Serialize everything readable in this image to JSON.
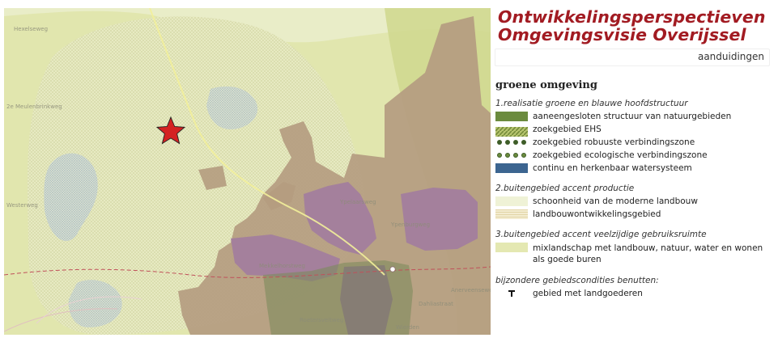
{
  "legend": {
    "title_line1": "Ontwikkelingsperspectieven",
    "title_line2": "Omgevingsvisie Overijssel",
    "subtitle": "aanduidingen",
    "section": "groene omgeving",
    "groups": [
      {
        "heading": "1.realisatie groene en blauwe hoofdstructuur",
        "items": [
          {
            "label": "aaneengesloten structuur van natuurgebieden",
            "color": "#6b8b3e"
          },
          {
            "label": "zoekgebied EHS",
            "color": "#8aa64a"
          },
          {
            "label": "zoekgebied robuuste verbindingszone",
            "color": "#3e5d28"
          },
          {
            "label": "zoekgebied ecologische verbindingszone",
            "color": "#6b8b3e"
          },
          {
            "label": "continu en herkenbaar watersysteem",
            "color": "#3c6590"
          }
        ]
      },
      {
        "heading": "2.buitengebied accent productie",
        "items": [
          {
            "label": "schoonheid van de moderne landbouw",
            "color": "#eff2d6"
          },
          {
            "label": "landbouwontwikkelingsgebied",
            "color": "#e9dfc0"
          }
        ]
      },
      {
        "heading": "3.buitengebied accent veelzijdige gebruiksruimte",
        "items": [
          {
            "label": "mixlandschap met landbouw, natuur, water en wonen als goede buren",
            "color": "#e4e8b2"
          }
        ]
      },
      {
        "heading": "bijzondere gebiedscondities benutten:",
        "items": [
          {
            "label": "gebied met landgoederen",
            "icon": "landgoed-icon"
          }
        ]
      }
    ]
  },
  "map": {
    "street_labels": [
      "Hexelseweg",
      "Ypelaarsweg",
      "Ypenburgweg",
      "Anerveenseweg",
      "Dahliastraat",
      "Wierden",
      "Mekkelhorstweg",
      "Roetersveltweg",
      "2e Meulenbrinkweg",
      "Westerweg"
    ],
    "marker": {
      "icon": "star-marker-icon",
      "color": "#d42222"
    },
    "colors": {
      "mixlandschap": "#e4e8b2",
      "moderne_landbouw": "#eff2d6",
      "urban_brown": "#b49c80",
      "industrial_purple": "#a27c9f",
      "railway": "#c0505a"
    }
  }
}
